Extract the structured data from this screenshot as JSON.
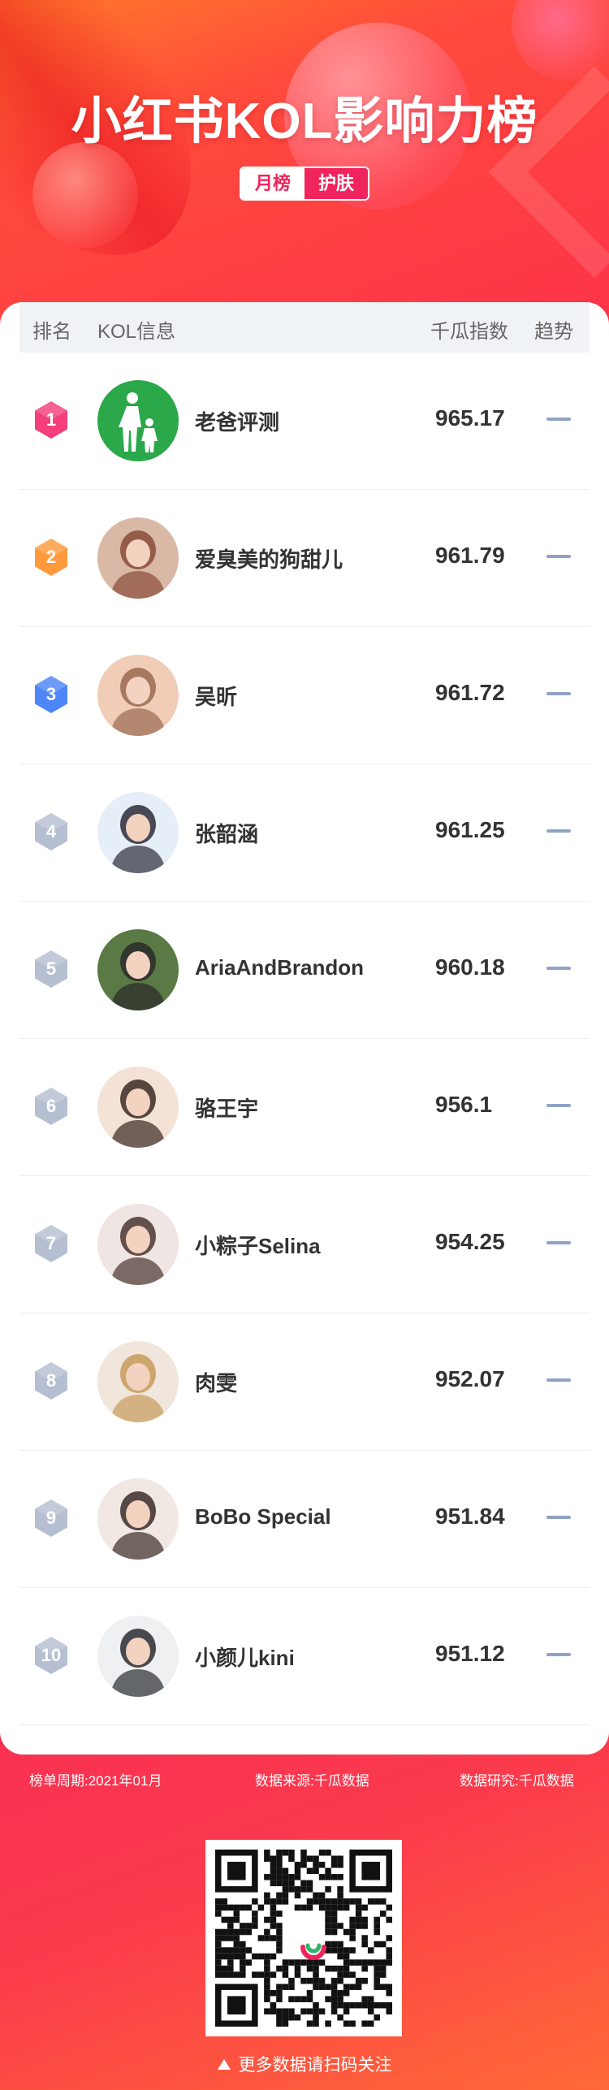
{
  "header": {
    "title": "小红书KOL影响力榜",
    "tags": [
      "月榜",
      "护肤"
    ]
  },
  "table": {
    "columns": {
      "rank": "排名",
      "info": "KOL信息",
      "score": "千瓜指数",
      "trend": "趋势"
    },
    "rows": [
      {
        "rank": "1",
        "name": "老爸评测",
        "score": "965.17",
        "trend": "flat-dash-icon"
      },
      {
        "rank": "2",
        "name": "爱臭美的狗甜儿",
        "score": "961.79",
        "trend": "flat-dash-icon"
      },
      {
        "rank": "3",
        "name": "吴昕",
        "score": "961.72",
        "trend": "flat-dash-icon"
      },
      {
        "rank": "4",
        "name": "张韶涵",
        "score": "961.25",
        "trend": "flat-dash-icon"
      },
      {
        "rank": "5",
        "name": "AriaAndBrandon",
        "score": "960.18",
        "trend": "flat-dash-icon"
      },
      {
        "rank": "6",
        "name": "骆王宇",
        "score": "956.1",
        "trend": "flat-dash-icon"
      },
      {
        "rank": "7",
        "name": "小粽子Selina",
        "score": "954.25",
        "trend": "flat-dash-icon"
      },
      {
        "rank": "8",
        "name": "肉雯",
        "score": "952.07",
        "trend": "flat-dash-icon"
      },
      {
        "rank": "9",
        "name": "BoBo Special",
        "score": "951.84",
        "trend": "flat-dash-icon"
      },
      {
        "rank": "10",
        "name": "小颜儿kini",
        "score": "951.12",
        "trend": "flat-dash-icon"
      }
    ]
  },
  "footer": {
    "period": "榜单周期:2021年01月",
    "source": "数据来源:千瓜数据",
    "research": "数据研究:千瓜数据",
    "qr_note": "更多数据请扫码关注"
  },
  "colors": {
    "brand": "#f0245c",
    "rank1": "#f43f7c",
    "rank2": "#ff9a3c",
    "rank3": "#4f86f7",
    "rank_other": "#b6bfd1",
    "trend": "#8fa3c4"
  }
}
